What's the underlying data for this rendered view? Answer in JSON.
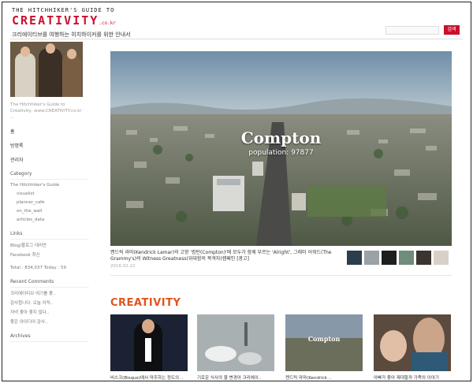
{
  "header": {
    "logo_top": "THE HITCHHIKER'S GUIDE TO",
    "logo_main": "CREATIVITY",
    "logo_suffix": ".co.kr",
    "tagline": "크리에이티브를 여행하는 히치하이커를 위한 안내서",
    "search_placeholder": "",
    "search_button": "검색"
  },
  "sidebar": {
    "description": "The Hitchhiker's Guide to Creativity, www.CREATIVITY.co.kr ...",
    "nav": [
      "홈",
      "방명록",
      "관리자"
    ],
    "category_title": "Category",
    "categories": [
      "The Hitchhiker's Guide",
      "visualist",
      "planner_cafe",
      "on_the_wall",
      "articles_data"
    ],
    "links_title": "Links",
    "links": [
      "Blog/블로그 대리만",
      "Facebook 최신"
    ],
    "total_line": "Total : 834,037  Today : 59",
    "recent_title": "Recent Comments",
    "recent_comments": [
      "크리에이티브 여기를 좋..",
      "감사합니다. 오늘 아직..",
      "저녁 좋아 좋지 않다..",
      "좋은 아이디어 감사.."
    ],
    "archives_title": "Archives"
  },
  "hero": {
    "title": "Compton",
    "subtitle": "population: 97877",
    "caption": "켄드릭 라마(Kendrick Lamar)의 고향 '컴턴(Compton)'에 모두가 함께 부르는 'Alright', 그래미 어워드(The Grammy's)의 Witness Greatness(위대함의 목격자)캠페인 [광고]",
    "date": "2016.02.22",
    "colors": {
      "sky_top": "#6f8ea8",
      "sky_bottom": "#b9c8cf",
      "city": "#6c6e5c"
    }
  },
  "section": {
    "title": "CREATIVITY",
    "cards": [
      {
        "caption": "비스크(Bisque)에서 마주하는 정도의 ..",
        "color": "#1a2233"
      },
      {
        "caption": "기로운 식사의 물 변경아 크리에이..",
        "color": "#a8b0b2"
      },
      {
        "caption": "켄드릭 라마(Kendrick ..",
        "color": "#8798a8",
        "mini_title": "Compton"
      },
      {
        "caption": "아빠가 좋아 제대할까 가족의 이야기",
        "color": "#5b4a3e"
      }
    ]
  }
}
